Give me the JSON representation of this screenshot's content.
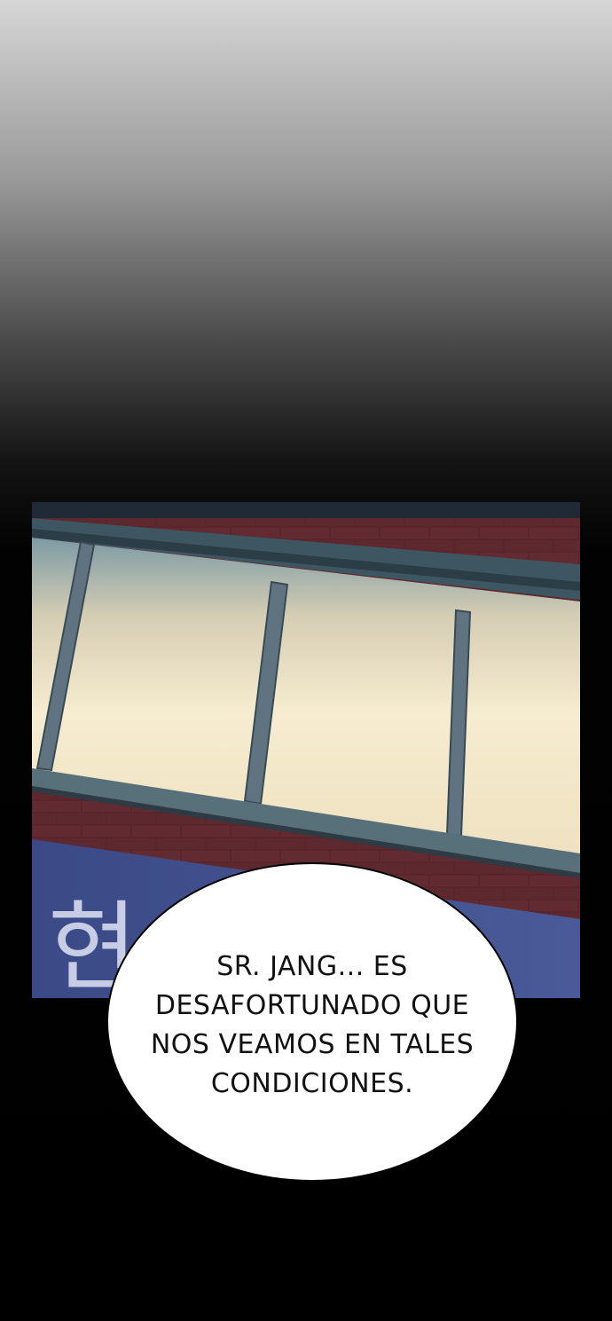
{
  "speech_bubble": {
    "lines": [
      "SR. JANG... ES",
      "DESAFORTUNADO QUE",
      "NOS VEAMOS EN TALES",
      "CONDICIONES."
    ]
  },
  "sign_text": "현",
  "colors": {
    "brick": "#6a2d33",
    "mortar": "#3a1a22",
    "window_glow": "#f3e7c7",
    "frame": "#6f8b94",
    "sign": "#3b4a86"
  }
}
